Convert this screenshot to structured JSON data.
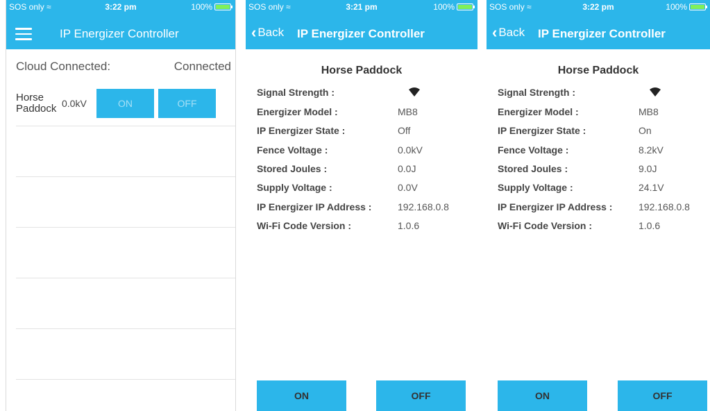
{
  "status": {
    "carrier": "SOS only",
    "battery": "100%",
    "screens_time": [
      "3:22 pm",
      "3:21 pm",
      "3:22 pm"
    ],
    "wifi_icon": "wifi-icon",
    "battery_fill_fraction": 1.0
  },
  "app_title": "IP Energizer Controller",
  "back_label": "Back",
  "list_screen": {
    "cloud_label": "Cloud Connected:",
    "cloud_value": "Connected",
    "device": {
      "name": "Horse Paddock",
      "voltage": "0.0kV",
      "on_label": "ON",
      "off_label": "OFF"
    }
  },
  "detail_labels": {
    "signal": "Signal Strength :",
    "model": "Energizer Model :",
    "state": "IP Energizer State :",
    "fence_voltage": "Fence Voltage :",
    "joules": "Stored Joules :",
    "supply": "Supply Voltage :",
    "ip": "IP Energizer IP Address :",
    "wifi_version": "Wi-Fi Code Version :"
  },
  "detail_off": {
    "title": "Horse Paddock",
    "model": "MB8",
    "state": "Off",
    "fence_voltage": "0.0kV",
    "joules": "0.0J",
    "supply": "0.0V",
    "ip": "192.168.0.8",
    "wifi_version": "1.0.6",
    "on_label": "ON",
    "off_label": "OFF"
  },
  "detail_on": {
    "title": "Horse Paddock",
    "model": "MB8",
    "state": "On",
    "fence_voltage": "8.2kV",
    "joules": "9.0J",
    "supply": "24.1V",
    "ip": "192.168.0.8",
    "wifi_version": "1.0.6",
    "on_label": "ON",
    "off_label": "OFF"
  },
  "colors": {
    "accent": "#2cb6ea",
    "battery": "#7ff05a"
  }
}
